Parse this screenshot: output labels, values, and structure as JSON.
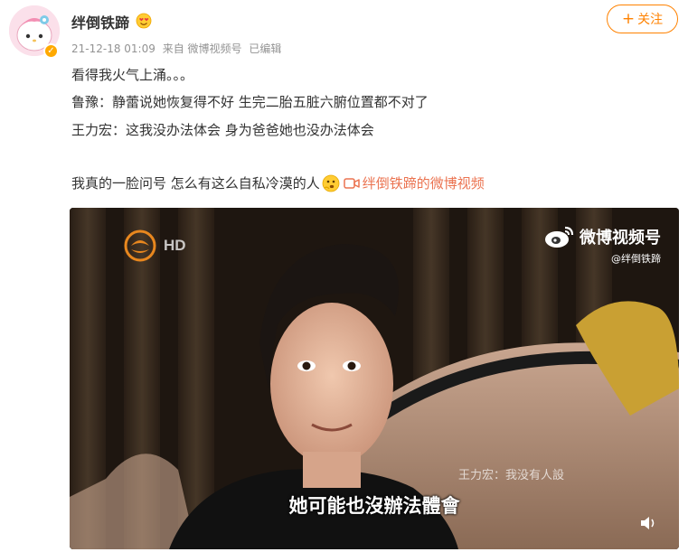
{
  "user": {
    "name": "绊倒铁蹄",
    "verified_mark": "✓"
  },
  "follow_button": {
    "plus": "+",
    "label": "关注"
  },
  "meta": {
    "time": "21-12-18 01:09",
    "source": "来自 微博视频号",
    "edited": "已编辑"
  },
  "post": {
    "line1": "看得我火气上涌。。。",
    "line2": "鲁豫：静蕾说她恢复得不好 生完二胎五脏六腑位置都不对了",
    "line3": "王力宏：这我没办法体会 身为爸爸她也没办法体会",
    "line4": "我真的一脸问号 怎么有这么自私冷漠的人",
    "video_link": "绊倒铁蹄的微博视频"
  },
  "video": {
    "channel_badge": "HD",
    "watermark_brand": "微博视频号",
    "watermark_handle": "@绊倒铁蹄",
    "caption_small": "王力宏：我没有人設",
    "caption_main": "她可能也沒辦法體會"
  },
  "colors": {
    "accent": "#ff8200",
    "link": "#eb7350",
    "meta": "#939393",
    "text": "#333333"
  }
}
